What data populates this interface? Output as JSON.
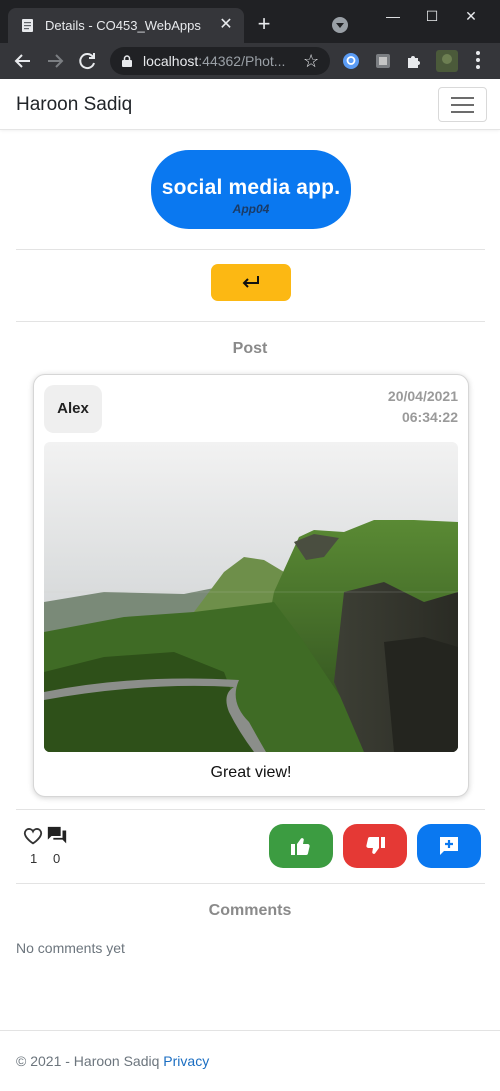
{
  "browser": {
    "tab_title": "Details - CO453_WebApps",
    "tab_close": "✕",
    "new_tab": "+",
    "url_host": "localhost",
    "url_rest": ":44362/Phot...",
    "win_minimize": "—",
    "win_maximize": "☐",
    "win_close": "✕",
    "star": "☆"
  },
  "navbar": {
    "brand": "Haroon Sadiq"
  },
  "logo": {
    "title": "social media app.",
    "subtitle": "App04",
    "color": "#0a78f0"
  },
  "back_button": {
    "icon": "return-arrow-icon",
    "color": "#fcb813"
  },
  "post_section": {
    "heading": "Post",
    "author": "Alex",
    "date": "20/04/2021",
    "time": "06:34:22",
    "image": "green mountain valley with winding road",
    "caption": "Great view!"
  },
  "stats": {
    "likes_icon": "heart-icon",
    "likes": "1",
    "comments_icon": "comments-icon",
    "comments": "0"
  },
  "actions": {
    "like": {
      "icon": "thumbs-up-icon",
      "color": "#3c9c41"
    },
    "dislike": {
      "icon": "thumbs-down-icon",
      "color": "#e53935"
    },
    "comment": {
      "icon": "add-comment-icon",
      "color": "#0a78f0"
    }
  },
  "comments_section": {
    "heading": "Comments",
    "empty_text": "No comments yet"
  },
  "footer": {
    "copyright": "© 2021 - Haroon Sadiq ",
    "privacy_link": "Privacy"
  }
}
